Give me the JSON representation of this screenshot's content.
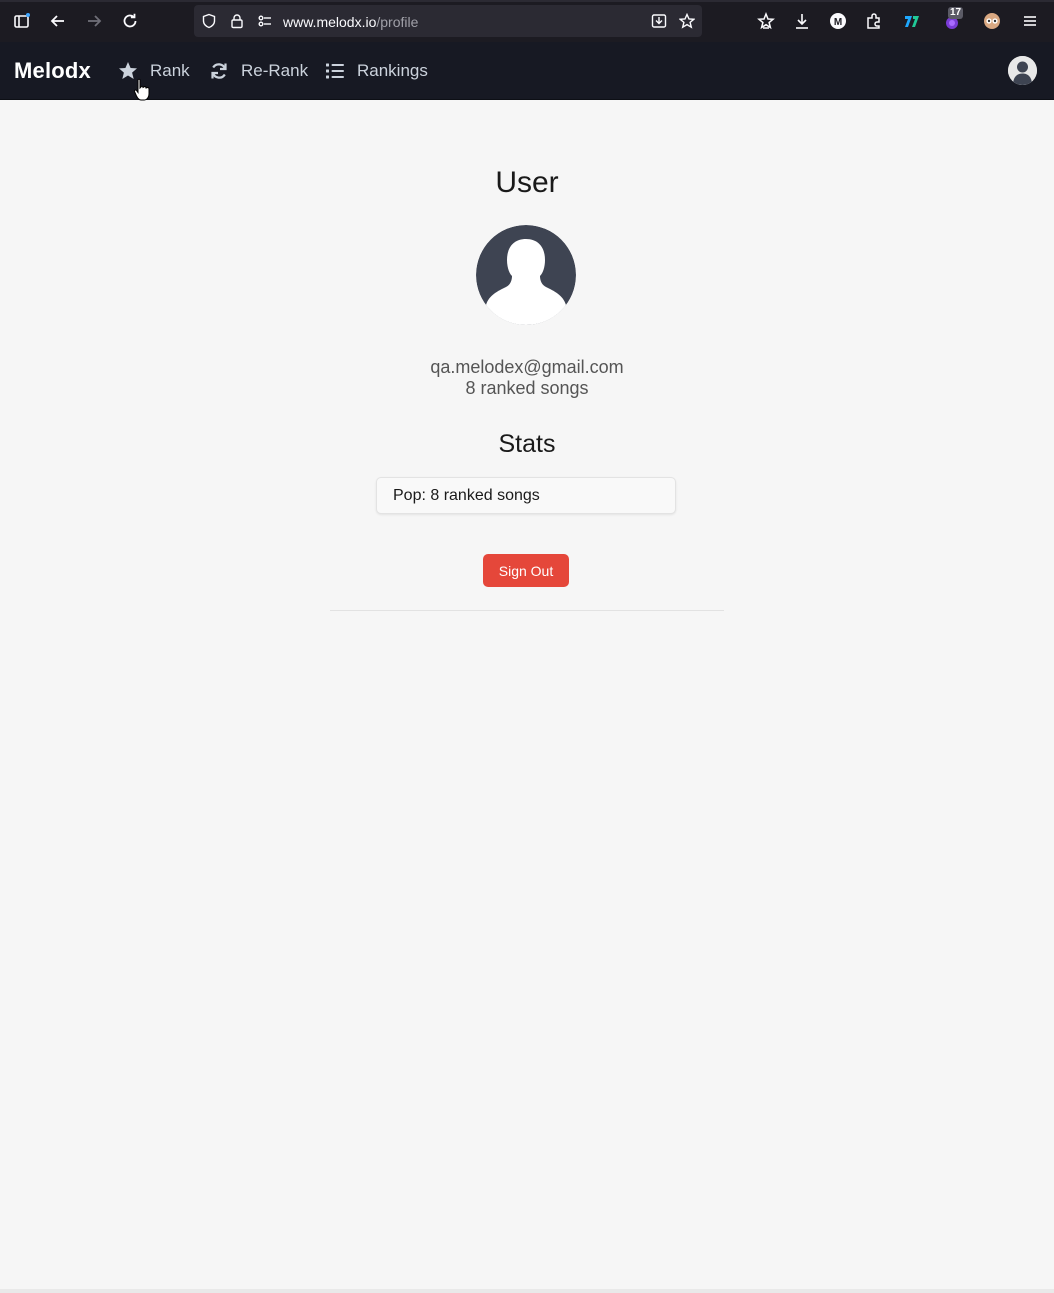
{
  "browser": {
    "url_host": "www.melodx.io",
    "url_path": "/profile",
    "extension_badge": "17",
    "icons": [
      "sidebar-icon",
      "back-icon",
      "forward-icon",
      "reload-icon",
      "shield-icon",
      "lock-icon",
      "permissions-icon",
      "download-page-icon",
      "bookmark-star-icon",
      "saved-bookmarks-icon",
      "downloads-icon",
      "m-extension-icon",
      "extensions-icon",
      "logo-extension-icon",
      "purple-extension-icon",
      "owl-extension-icon",
      "menu-icon"
    ]
  },
  "navbar": {
    "brand": "Melodx",
    "items": [
      {
        "label": "Rank",
        "icon": "star-icon"
      },
      {
        "label": "Re-Rank",
        "icon": "refresh-icon"
      },
      {
        "label": "Rankings",
        "icon": "list-icon"
      }
    ]
  },
  "profile": {
    "title": "User",
    "email": "qa.melodex@gmail.com",
    "ranked_summary": "8 ranked songs",
    "stats_title": "Stats",
    "stats": [
      {
        "label": "Pop: 8 ranked songs"
      }
    ],
    "sign_out_label": "Sign Out"
  },
  "colors": {
    "navbar_bg": "#171923",
    "page_bg": "#f6f6f6",
    "sign_out_bg": "#e5473a",
    "avatar_fill": "#3e4452"
  }
}
